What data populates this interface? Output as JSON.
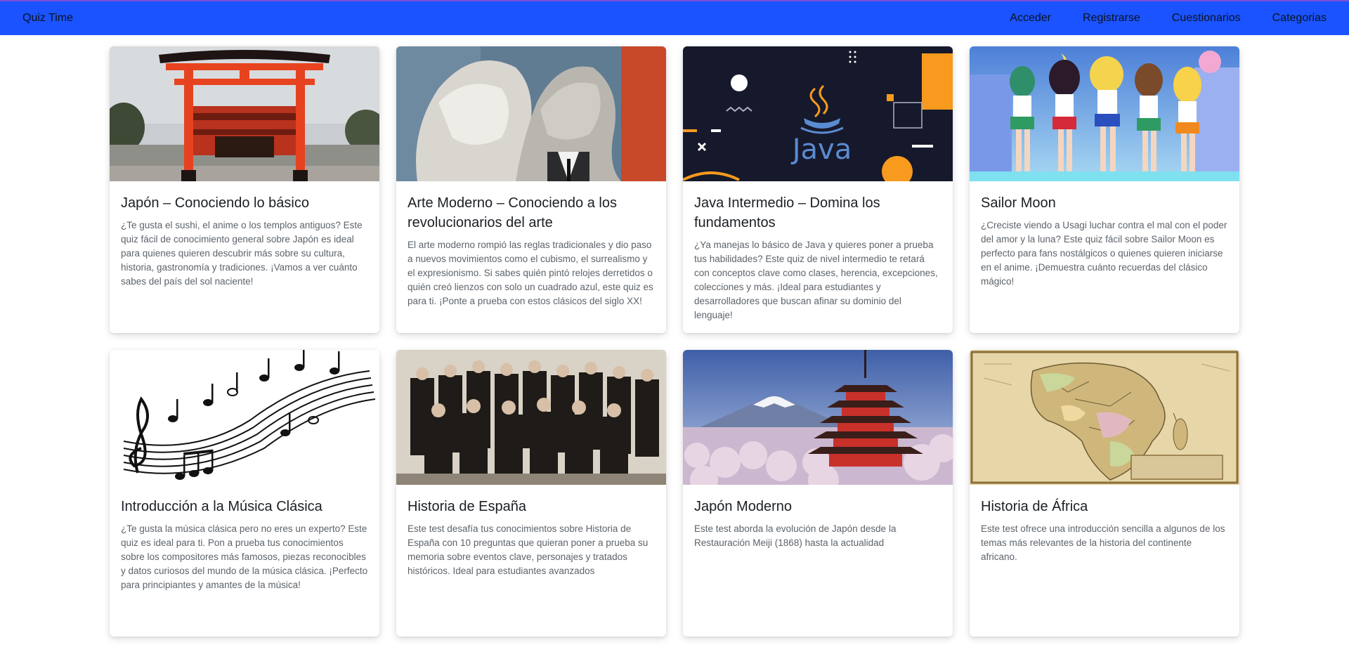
{
  "navbar": {
    "brand": "Quiz Time",
    "links": [
      "Acceder",
      "Registrarse",
      "Cuestionarios",
      "Categorias"
    ],
    "bg_color": "#1a53ff"
  },
  "cards": [
    {
      "image": "torii-gate-image",
      "title": "Japón – Conociendo lo básico",
      "description": "¿Te gusta el sushi, el anime o los templos antiguos? Este quiz fácil de conocimiento general sobre Japón es ideal para quienes quieren descubrir más sobre su cultura, historia, gastronomía y tradiciones. ¡Vamos a ver cuánto sabes del país del sol naciente!"
    },
    {
      "image": "lovers-painting-image",
      "title": "Arte Moderno – Conociendo a los revolucionarios del arte",
      "description": "El arte moderno rompió las reglas tradicionales y dio paso a nuevos movimientos como el cubismo, el surrealismo y el expresionismo. Si sabes quién pintó relojes derretidos o quién creó lienzos con solo un cuadrado azul, este quiz es para ti. ¡Ponte a prueba con estos clásicos del siglo XX!"
    },
    {
      "image": "java-logo-image",
      "title": "Java Intermedio – Domina los fundamentos",
      "description": "¿Ya manejas lo básico de Java y quieres poner a prueba tus habilidades? Este quiz de nivel intermedio te retará con conceptos clave como clases, herencia, excepciones, colecciones y más. ¡Ideal para estudiantes y desarrolladores que buscan afinar su dominio del lenguaje!"
    },
    {
      "image": "sailor-moon-image",
      "title": "Sailor Moon",
      "description": "¿Creciste viendo a Usagi luchar contra el mal con el poder del amor y la luna? Este quiz fácil sobre Sailor Moon es perfecto para fans nostálgicos o quienes quieren iniciarse en el anime. ¡Demuestra cuánto recuerdas del clásico mágico!"
    },
    {
      "image": "music-notes-image",
      "title": "Introducción a la Música Clásica",
      "description": "¿Te gusta la música clásica pero no eres un experto? Este quiz es ideal para ti. Pon a prueba tus conocimientos sobre los compositores más famosos, piezas reconocibles y datos curiosos del mundo de la música clásica. ¡Perfecto para principiantes y amantes de la música!"
    },
    {
      "image": "historic-group-photo-image",
      "title": "Historia de España",
      "description": "Este test desafía tus conocimientos sobre Historia de España con 10 preguntas que quieran poner a prueba su memoria sobre eventos clave, personajes y tratados históricos. Ideal para estudiantes avanzados"
    },
    {
      "image": "pagoda-fuji-image",
      "title": "Japón Moderno",
      "description": "Este test aborda la evolución de Japón desde la Restauración Meiji (1868) hasta la actualidad"
    },
    {
      "image": "africa-map-image",
      "title": "Historia de África",
      "description": "Este test ofrece una introducción sencilla a algunos de los temas más relevantes de la historia del continente africano."
    }
  ]
}
